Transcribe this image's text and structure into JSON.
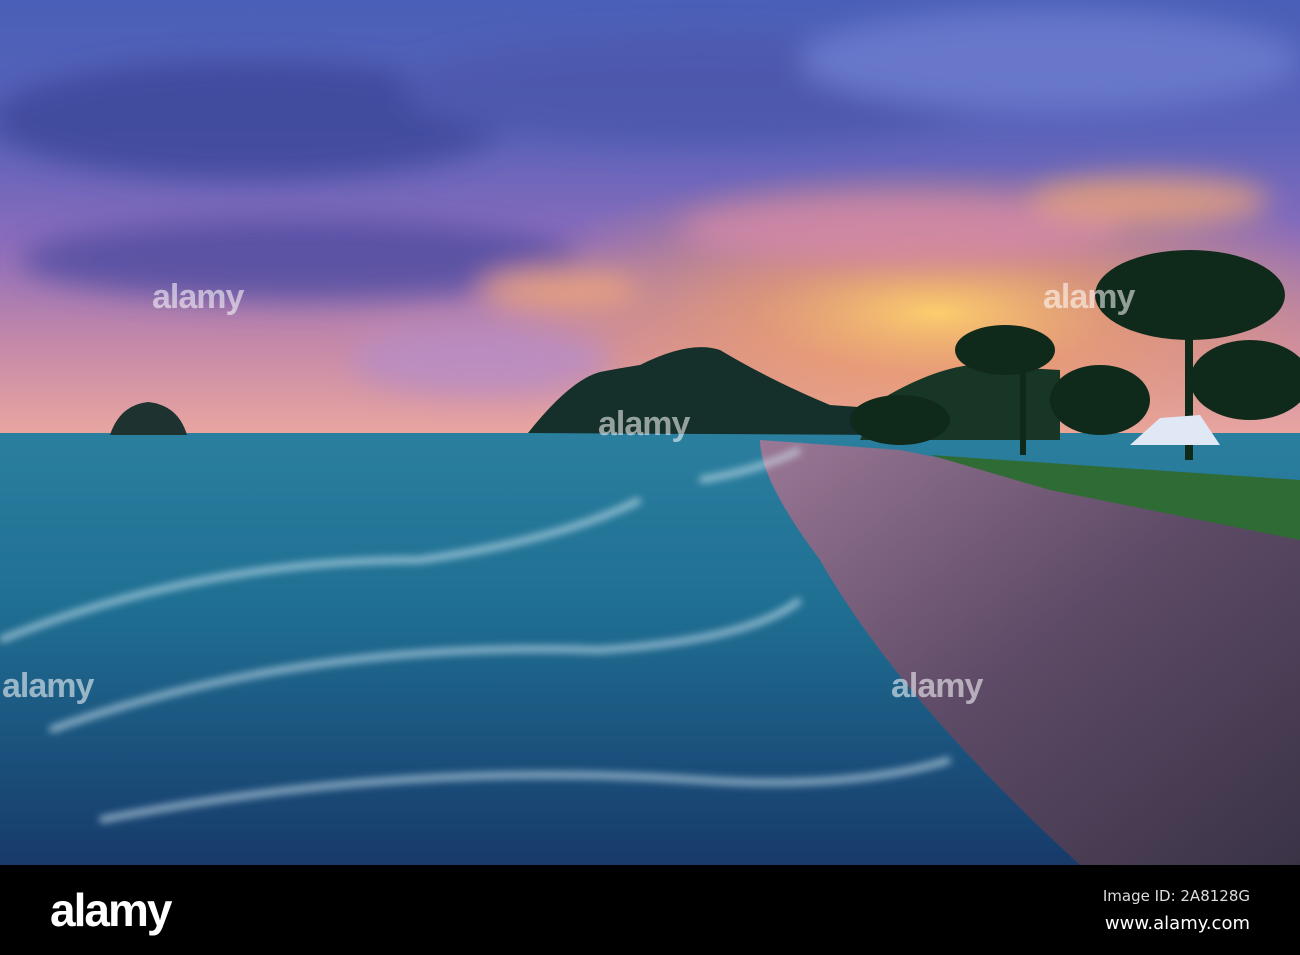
{
  "watermark": {
    "text": "alamy"
  },
  "footer": {
    "logo": "alamy",
    "image_id": "Image ID: 2A8128G",
    "url": "www.alamy.com"
  }
}
